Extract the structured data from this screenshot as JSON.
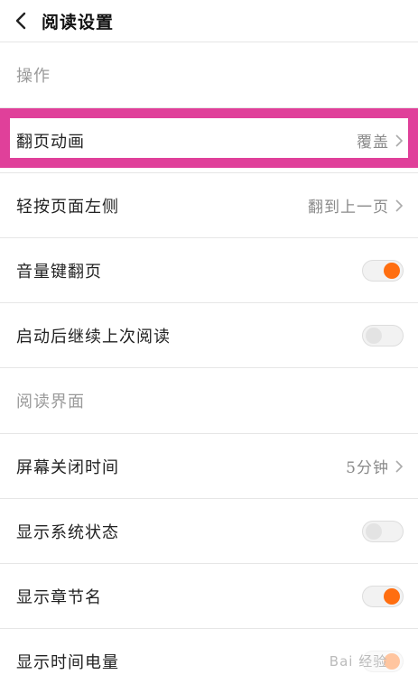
{
  "header": {
    "title": "阅读设置"
  },
  "sections": {
    "operation": "操作",
    "reading_ui": "阅读界面"
  },
  "rows": {
    "page_animation": {
      "label": "翻页动画",
      "value": "覆盖"
    },
    "tap_left": {
      "label": "轻按页面左侧",
      "value": "翻到上一页"
    },
    "volume_key": {
      "label": "音量键翻页",
      "toggle": "on"
    },
    "resume_reading": {
      "label": "启动后继续上次阅读",
      "toggle": "off"
    },
    "screen_off": {
      "label": "屏幕关闭时间",
      "value": "5分钟"
    },
    "system_status": {
      "label": "显示系统状态",
      "toggle": "off"
    },
    "chapter_name": {
      "label": "显示章节名",
      "toggle": "on"
    },
    "time_battery": {
      "label": "显示时间电量",
      "toggle": "on"
    }
  },
  "colors": {
    "accent": "#ff6e10",
    "highlight": "#e0409a"
  },
  "watermark": {
    "text": "Bai 经验"
  }
}
